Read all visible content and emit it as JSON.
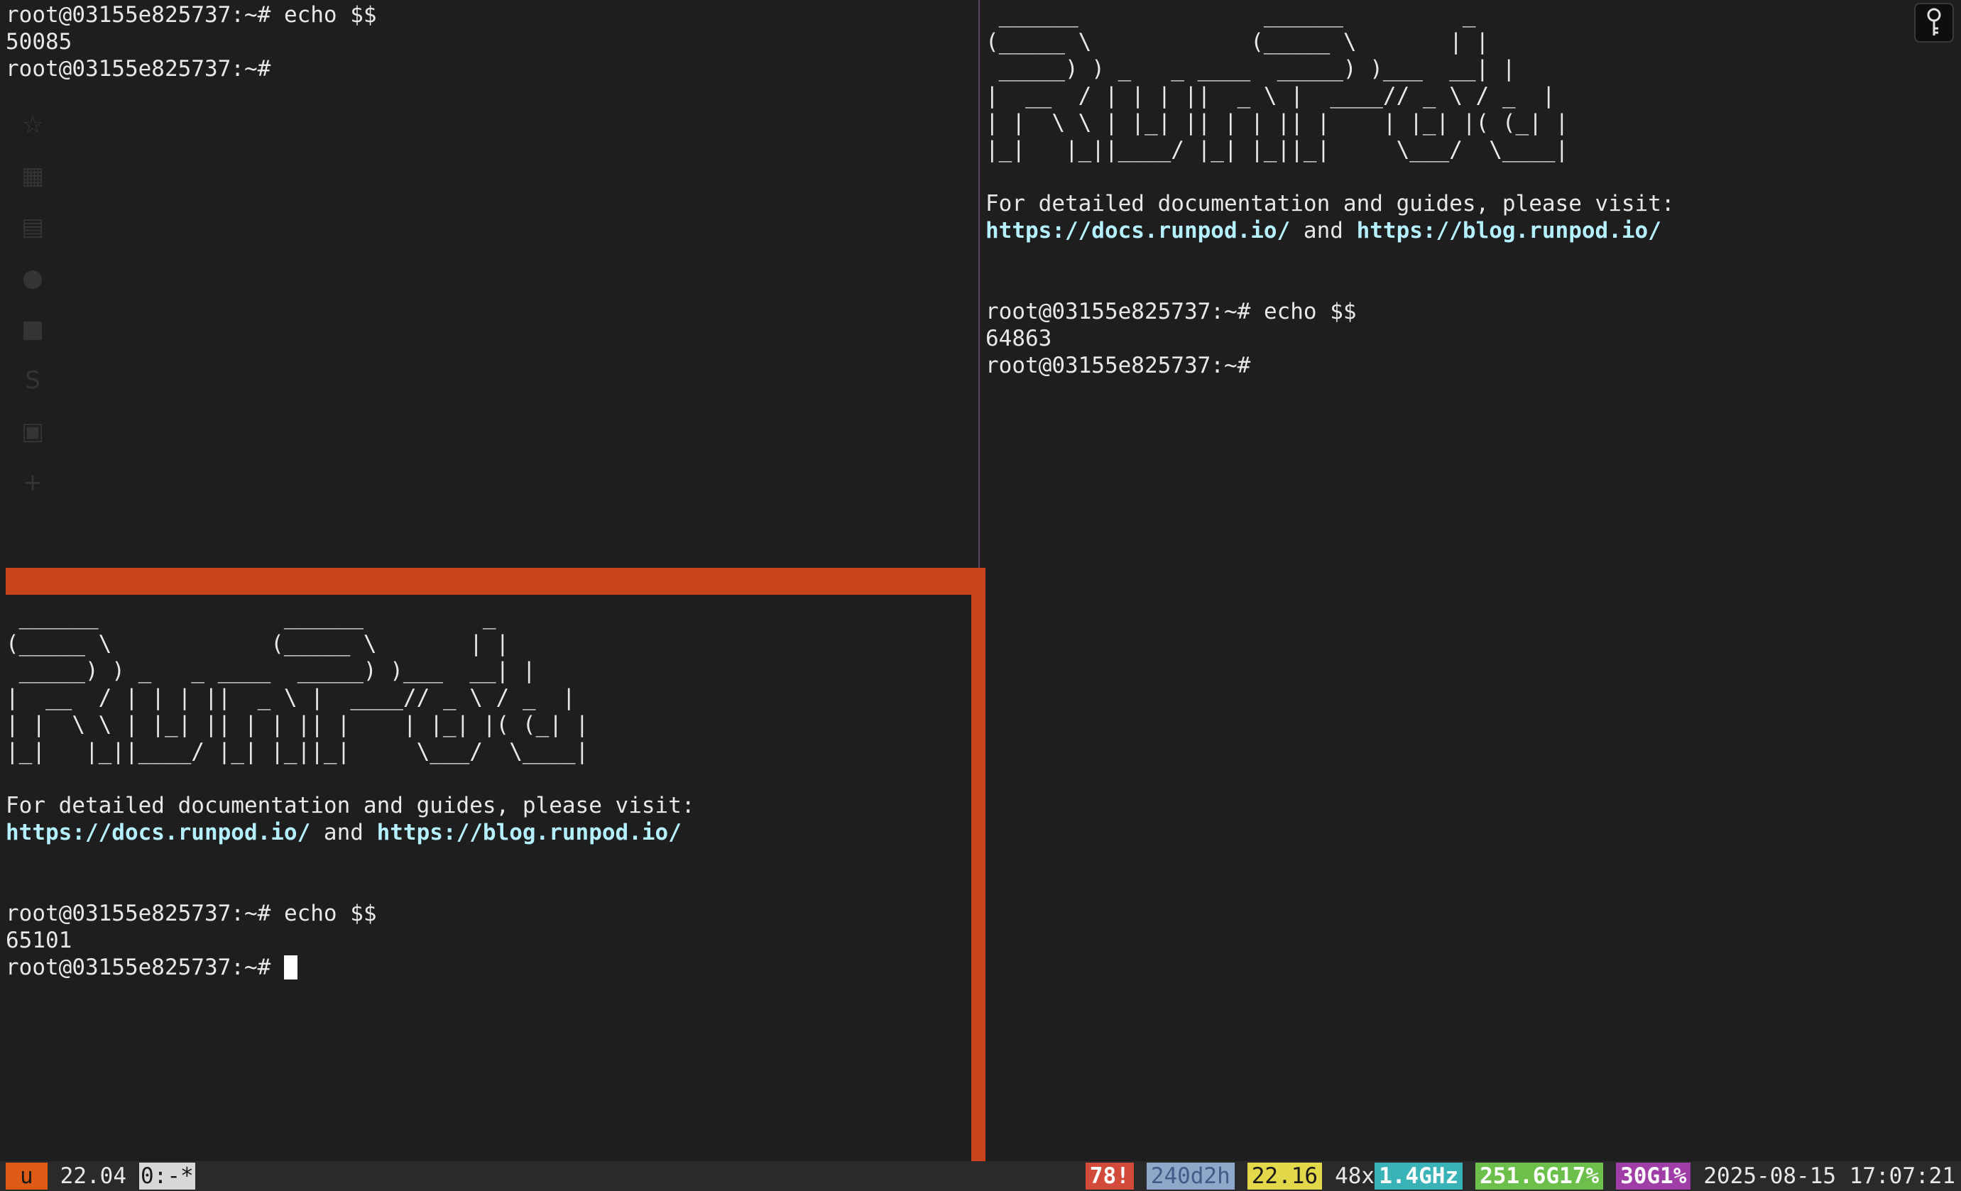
{
  "prompt": "root@03155e825737:~#",
  "panes": {
    "top_left": {
      "line1_cmd": " echo $$",
      "line2_output": "50085",
      "line3_prompt": "root@03155e825737:~#"
    },
    "top_right": {
      "banner_art": " ______              ______         _ \n(_____ \\            (_____ \\       | |\n _____) ) _   _ ____  _____) )___  __| |\n|  __  / | | | ||  _ \\ |  ____// _ \\ / _  |\n| |  \\ \\ | |_| || | | || |    | |_| |( (_| |\n|_|   |_||____/ |_| |_||_|     \\___/  \\____|",
      "docs_text": "For detailed documentation and guides, please visit:",
      "docs_link": "https://docs.runpod.io/",
      "and_text": " and ",
      "blog_link": "https://blog.runpod.io/",
      "cmd": " echo $$",
      "output": "64863"
    },
    "bottom_left": {
      "banner_art": " ______              ______         _ \n(_____ \\            (_____ \\       | |\n _____) ) _   _ ____  _____) )___  __| |\n|  __  / | | | ||  _ \\ |  ____// _ \\ / _  |\n| |  \\ \\ | |_| || | | || |    | |_| |( (_| |\n|_|   |_||____/ |_| |_||_|     \\___/  \\____|",
      "docs_text": "For detailed documentation and guides, please visit:",
      "docs_link": "https://docs.runpod.io/",
      "and_text": " and ",
      "blog_link": "https://blog.runpod.io/",
      "cmd": " echo $$",
      "output": "65101"
    }
  },
  "status_bar": {
    "session": "u",
    "version": "22.04",
    "window": "0:-*",
    "alerts": "78!",
    "uptime": "240d2h",
    "load": "22.16",
    "cores": "48x",
    "cpu_freq": "1.4GHz",
    "mem": "251.6G17%",
    "gpu": "30G1%",
    "datetime": "2025-08-15 17:07:21"
  },
  "colors": {
    "background": "#1e1e1e",
    "active_border": "#c8431b",
    "link": "#b4f0ff",
    "status_bg": "#2a2a2a"
  },
  "icons": [
    "key-icon"
  ]
}
